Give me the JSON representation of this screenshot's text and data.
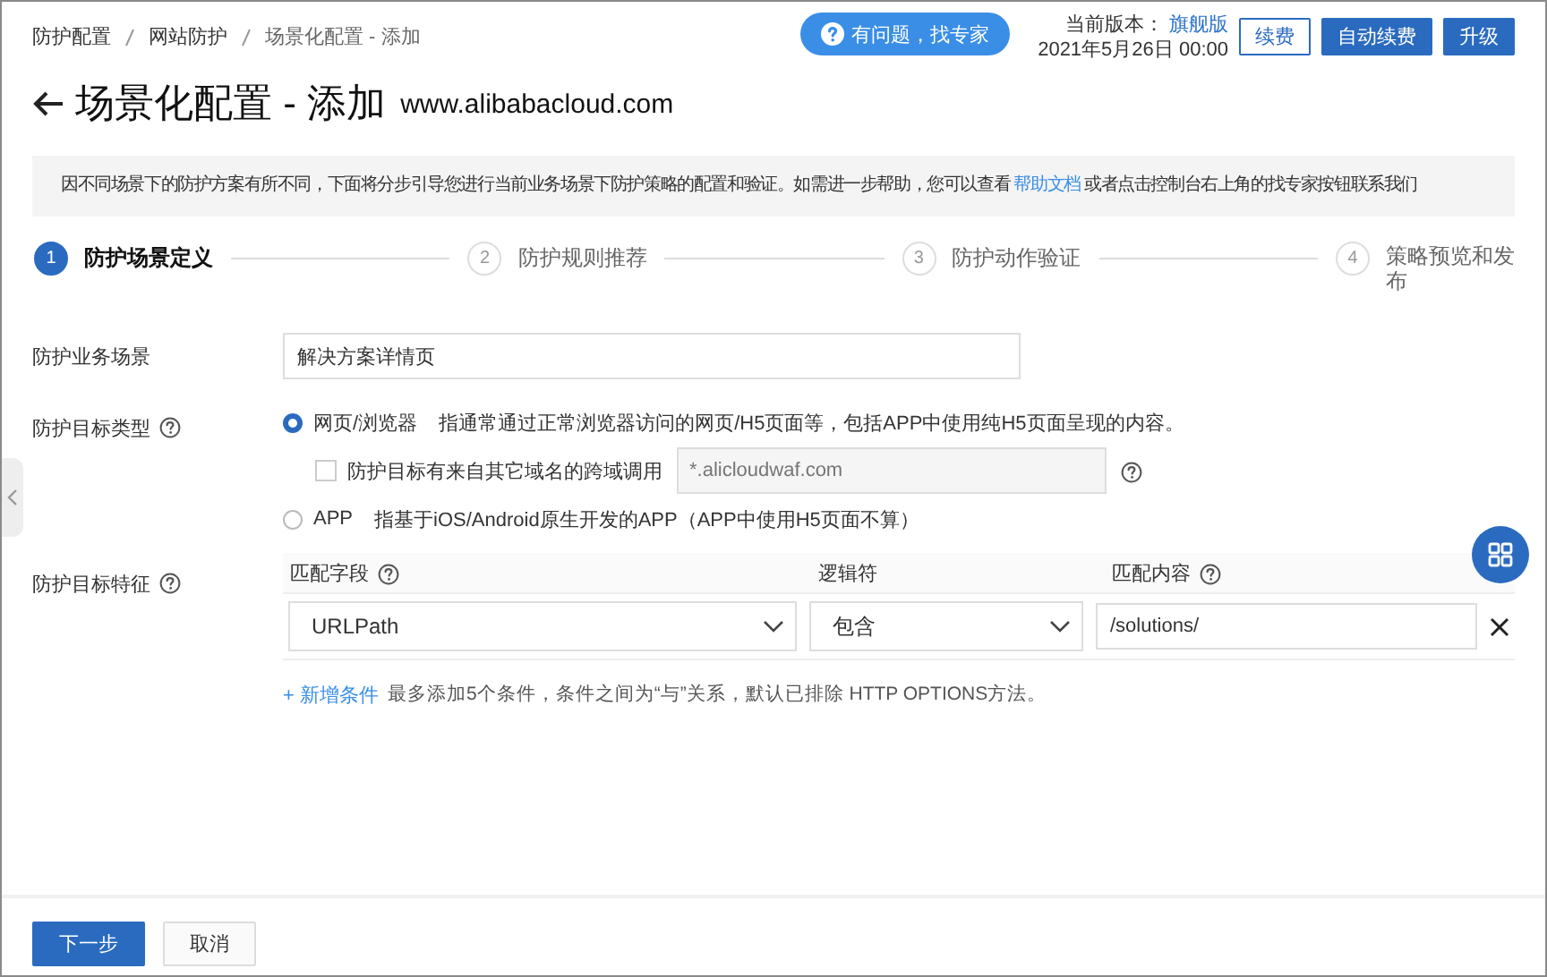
{
  "breadcrumb": [
    "防护配置",
    "网站防护",
    "场景化配置 - 添加"
  ],
  "help_button": "有问题，找专家",
  "version": {
    "label": "当前版本：",
    "edition": "旗舰版",
    "date": "2021年5月26日 00:00"
  },
  "header_buttons": [
    {
      "label": "续费",
      "kind": "outline"
    },
    {
      "label": "自动续费",
      "kind": "primary"
    },
    {
      "label": "升级",
      "kind": "primary"
    }
  ],
  "title": "场景化配置 - 添加",
  "domain": "www.alibabacloud.com",
  "notice": {
    "text": "因不同场景下的防护方案有所不同，下面将分步引导您进行当前业务场景下防护策略的配置和验证。如需进一步帮助，您可以查看",
    "link": "帮助文档",
    "after": "或者点击控制台右上角的找专家按钮联系我们"
  },
  "steps": [
    {
      "number": "1",
      "label": "防护场景定义",
      "selected": true
    },
    {
      "number": "2",
      "label": "防护规则推荐",
      "selected": false
    },
    {
      "number": "3",
      "label": "防护动作验证",
      "selected": false
    },
    {
      "number": "4",
      "label": "策略预览和发布",
      "selected": false
    }
  ],
  "scene": {
    "label": "防护业务场景",
    "value": "解决方案详情页"
  },
  "target_type": {
    "label": "防护目标类型",
    "options": [
      {
        "label": "网页/浏览器",
        "description": "指通常通过正常浏览器访问的网页/H5页面等，包括APP中使用纯H5页面呈现的内容。",
        "selected": true
      },
      {
        "label": "APP",
        "description": "指基于iOS/Android原生开发的APP（APP中使用H5页面不算）",
        "selected": false
      }
    ],
    "cross_domain": {
      "label": "防护目标有来自其它域名的跨域调用",
      "checked": false,
      "placeholder": "*.alicloudwaf.com"
    }
  },
  "features": {
    "label": "防护目标特征",
    "columns": [
      {
        "label": "匹配字段",
        "help": true
      },
      {
        "label": "逻辑符",
        "help": false
      },
      {
        "label": "匹配内容",
        "help": true
      }
    ],
    "rows": [
      {
        "field": "URLPath",
        "operator": "包含",
        "value": "/solutions/"
      }
    ],
    "add_link": "+ 新增条件",
    "add_hint": "最多添加5个条件，条件之间为“与”关系，默认已排除 HTTP OPTIONS方法。"
  },
  "footer_buttons": [
    {
      "label": "下一步",
      "kind": "primary"
    },
    {
      "label": "取消",
      "kind": "default"
    }
  ]
}
